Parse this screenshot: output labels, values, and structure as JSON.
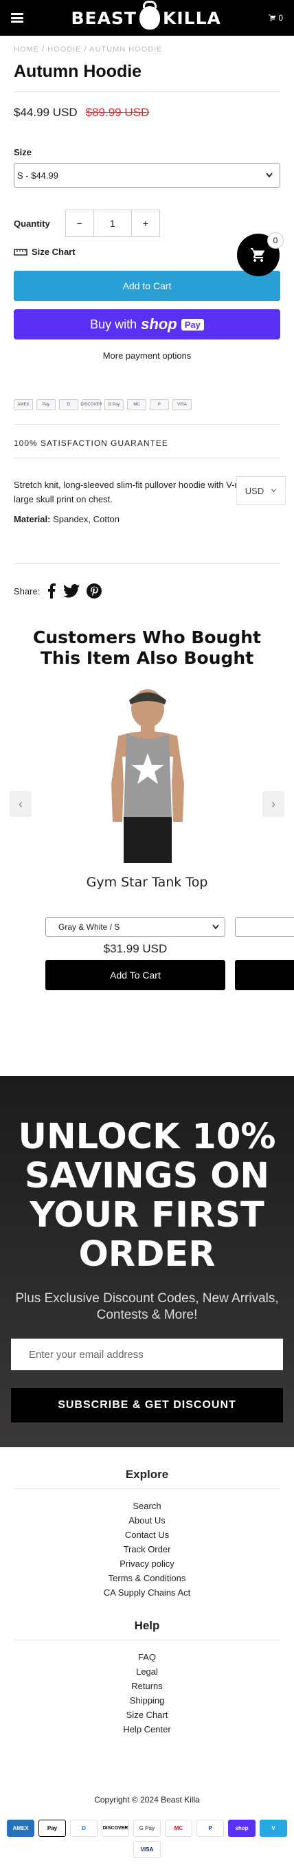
{
  "header": {
    "logo_left": "BEAST",
    "logo_right": "KILLA",
    "cart_count": "0"
  },
  "breadcrumb": [
    "HOME",
    "HOODIE",
    "AUTUMN HOODIE"
  ],
  "product": {
    "title": "Autumn Hoodie",
    "price": "$44.99 USD",
    "compare_price": "$89.99 USD",
    "size_label": "Size",
    "size_value": "S - $44.99",
    "quantity_label": "Quantity",
    "quantity": "1",
    "size_chart": "Size Chart",
    "add_to_cart": "Add to Cart",
    "buy_with": "Buy with",
    "shop_pay": "shop",
    "pay": "Pay",
    "more_payment": "More payment options",
    "guarantee": "100% SATISFACTION GUARANTEE",
    "description": "Stretch knit, long-sleeved slim-fit pullover hoodie with V-neck. With large skull print on chest.",
    "material_label": "Material:",
    "material": "Spandex, Cotton",
    "share": "Share:"
  },
  "floating_cart_count": "0",
  "currency": "USD",
  "also_bought": {
    "title": "Customers Who Bought This Item Also Bought",
    "item_title": "Gym Star Tank Top",
    "variant": "Gray & White / S",
    "price": "$31.99 USD",
    "button": "Add To Cart"
  },
  "promo": {
    "headline": "UNLOCK 10% SAVINGS ON YOUR FIRST ORDER",
    "subtext": "Plus Exclusive Discount Codes, New Arrivals, Contests & More!",
    "email_placeholder": "Enter your email address",
    "button": "SUBSCRIBE & GET DISCOUNT"
  },
  "footer": {
    "explore_title": "Explore",
    "explore": [
      "Search",
      "About Us",
      "Contact Us",
      "Track Order",
      "Privacy policy",
      "Terms & Conditions",
      "CA Supply Chains Act"
    ],
    "help_title": "Help",
    "help": [
      "FAQ",
      "Legal",
      "Returns",
      "Shipping",
      "Size Chart",
      "Help Center"
    ],
    "copyright": "Copyright © 2024 Beast Killa"
  },
  "payment_icons": [
    "AMEX",
    "Pay",
    "D",
    "DISCOVER",
    "G Pay",
    "MC",
    "P",
    "shop",
    "V",
    "VISA"
  ]
}
